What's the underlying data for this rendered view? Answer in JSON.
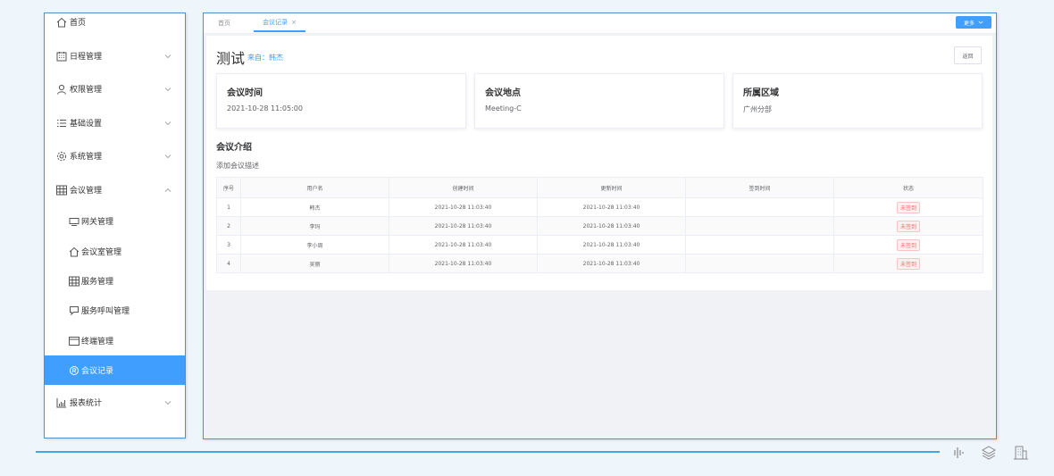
{
  "sidebar": {
    "items": [
      {
        "label": "首页",
        "icon": "home-icon",
        "expandable": false
      },
      {
        "label": "日程管理",
        "icon": "calendar-icon",
        "expandable": true
      },
      {
        "label": "权限管理",
        "icon": "user-icon",
        "expandable": true
      },
      {
        "label": "基础设置",
        "icon": "list-icon",
        "expandable": true
      },
      {
        "label": "系统管理",
        "icon": "gear-icon",
        "expandable": true
      },
      {
        "label": "会议管理",
        "icon": "grid-icon",
        "expandable": true,
        "expanded": true
      },
      {
        "label": "网关管理",
        "icon": "monitor-icon",
        "sub": true
      },
      {
        "label": "会议室管理",
        "icon": "home-icon",
        "sub": true
      },
      {
        "label": "服务管理",
        "icon": "grid-icon",
        "sub": true
      },
      {
        "label": "服务呼叫管理",
        "icon": "chat-icon",
        "sub": true
      },
      {
        "label": "终端管理",
        "icon": "terminal-icon",
        "sub": true
      },
      {
        "label": "会议记录",
        "icon": "record-icon",
        "sub": true,
        "active": true
      },
      {
        "label": "报表统计",
        "icon": "chart-icon",
        "expandable": true
      }
    ]
  },
  "tabs": {
    "home": "首页",
    "active": "会议记录",
    "close": "×",
    "more": "更多"
  },
  "meeting": {
    "title": "测试",
    "from": "来自：韩杰",
    "return_label": "返回",
    "info": [
      {
        "heading": "会议时间",
        "value": "2021-10-28 11:05:00"
      },
      {
        "heading": "会议地点",
        "value": "Meeting-C"
      },
      {
        "heading": "所属区域",
        "value": "广州分部"
      }
    ],
    "intro_title": "会议介绍",
    "intro_desc": "添加会议描述"
  },
  "table": {
    "headers": [
      "序号",
      "用户名",
      "创建时间",
      "更新时间",
      "签到时间",
      "状态"
    ],
    "rows": [
      {
        "no": "1",
        "user": "韩杰",
        "created": "2021-10-28 11:03:40",
        "updated": "2021-10-28 11:03:40",
        "signin": "",
        "status": "未签到"
      },
      {
        "no": "2",
        "user": "李玛",
        "created": "2021-10-28 11:03:40",
        "updated": "2021-10-28 11:03:40",
        "signin": "",
        "status": "未签到"
      },
      {
        "no": "3",
        "user": "李小周",
        "created": "2021-10-28 11:03:40",
        "updated": "2021-10-28 11:03:40",
        "signin": "",
        "status": "未签到"
      },
      {
        "no": "4",
        "user": "吴丽",
        "created": "2021-10-28 11:03:40",
        "updated": "2021-10-28 11:03:40",
        "signin": "",
        "status": "未签到"
      }
    ]
  },
  "colors": {
    "accent": "#409eff",
    "danger": "#f56c6c",
    "frame": "#4f8fd0"
  },
  "bottom_icons": [
    "waveform-icon",
    "layers-icon",
    "building-icon"
  ]
}
